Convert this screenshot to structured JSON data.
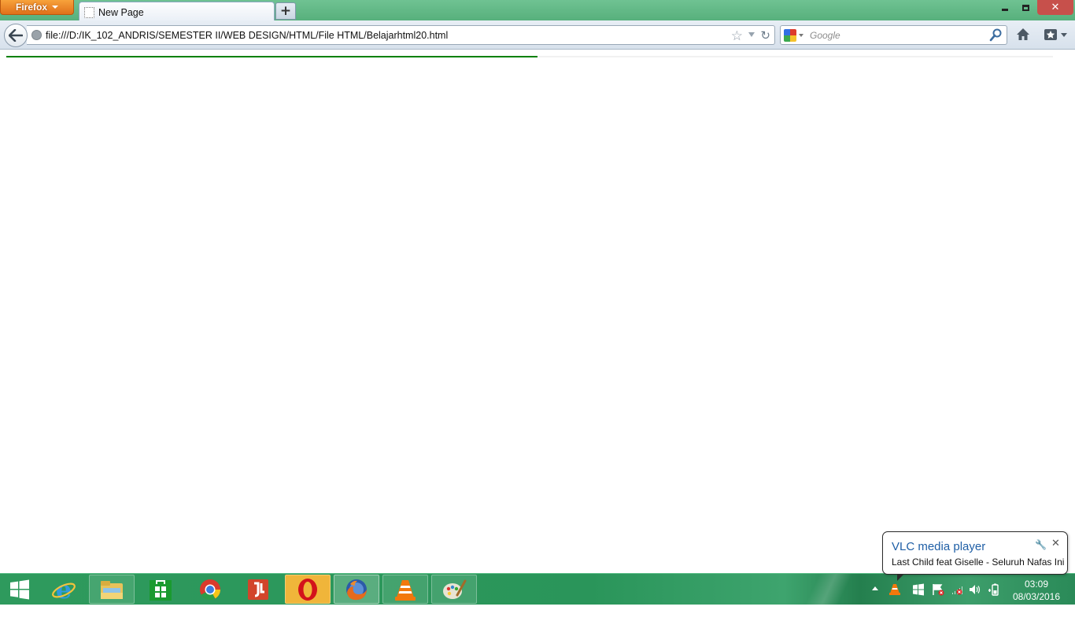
{
  "browser": {
    "menu_button_label": "Firefox",
    "tab_title": "New Page",
    "new_tab_label": "+",
    "close_label": "✕",
    "url": "file:///D:/IK_102_ANDRIS/SEMESTER II/WEB DESIGN/HTML/File HTML/Belajarhtml20.html",
    "search_placeholder": "Google",
    "icons": [
      "back-arrow-icon",
      "globe-icon",
      "bookmark-star-icon",
      "dropdown-icon",
      "reload-icon",
      "google-icon",
      "search-magnifier-icon",
      "home-icon",
      "bookmarks-icon"
    ]
  },
  "page": {
    "hr_color": "#008000"
  },
  "notification": {
    "title": "VLC media player",
    "text": "Last Child feat Giselle - Seluruh Nafas Ini"
  },
  "taskbar": {
    "apps": [
      "start",
      "internet-explorer",
      "file-explorer",
      "windows-store",
      "chrome",
      "foxit-reader",
      "opera",
      "firefox",
      "vlc",
      "paint"
    ],
    "clock_time": "03:09",
    "clock_date": "08/03/2016"
  },
  "colors": {
    "title_bar": "#57b07c",
    "firefox_button": "#e0701a",
    "taskbar": "#2a955a",
    "close_button": "#c7504b"
  }
}
